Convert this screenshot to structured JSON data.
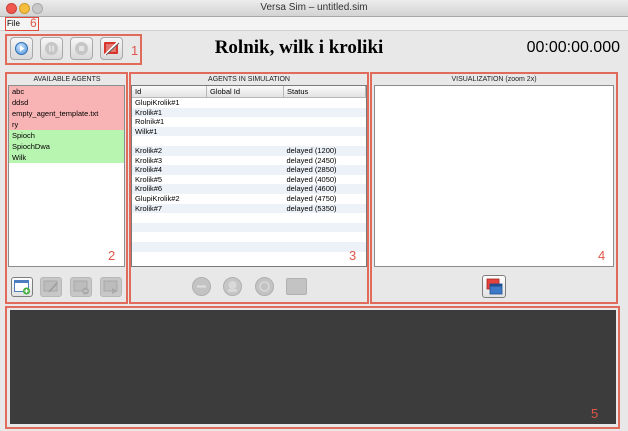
{
  "window": {
    "title": "Versa Sim – untitled.sim"
  },
  "menu": {
    "file_label": "File"
  },
  "toolbar": {
    "simulation_title": "Rolnik, wilk i kroliki",
    "clock": "00:00:00.000",
    "buttons": [
      {
        "name": "play",
        "icon": "play-icon"
      },
      {
        "name": "pause",
        "icon": "pause-icon"
      },
      {
        "name": "stop",
        "icon": "stop-icon"
      },
      {
        "name": "tools",
        "icon": "tools-icon"
      }
    ]
  },
  "annotations": [
    "1",
    "2",
    "3",
    "4",
    "5",
    "6"
  ],
  "available_agents": {
    "title": "AVAILABLE AGENTS",
    "items": [
      {
        "label": "abc",
        "color": "#f8b4b4"
      },
      {
        "label": "ddsd",
        "color": "#f8b4b4"
      },
      {
        "label": "empty_agent_template.txt",
        "color": "#f8b4b4"
      },
      {
        "label": "ry",
        "color": "#f8b4b4"
      },
      {
        "label": "Spioch",
        "color": "#b8f5b0"
      },
      {
        "label": "SpiochDwa",
        "color": "#b8f5b0"
      },
      {
        "label": "Wilk",
        "color": "#b8f5b0"
      }
    ]
  },
  "agents_in_simulation": {
    "title": "AGENTS IN SIMULATION",
    "columns": [
      "Id",
      "Global Id",
      "Status"
    ],
    "rows": [
      [
        "GlupiKrolik#1",
        "",
        ""
      ],
      [
        "Krolik#1",
        "",
        ""
      ],
      [
        "Rolnik#1",
        "",
        ""
      ],
      [
        "Wilk#1",
        "",
        ""
      ],
      [
        "",
        "",
        ""
      ],
      [
        "Krolik#2",
        "",
        "delayed (1200)"
      ],
      [
        "Krolik#3",
        "",
        "delayed (2450)"
      ],
      [
        "Krolik#4",
        "",
        "delayed (2850)"
      ],
      [
        "Krolik#5",
        "",
        "delayed (4050)"
      ],
      [
        "Krolik#6",
        "",
        "delayed (4600)"
      ],
      [
        "GlupiKrolik#2",
        "",
        "delayed (4750)"
      ],
      [
        "Krolik#7",
        "",
        "delayed (5350)"
      ]
    ]
  },
  "visualization": {
    "title": "VISUALIZATION (zoom 2x)"
  }
}
